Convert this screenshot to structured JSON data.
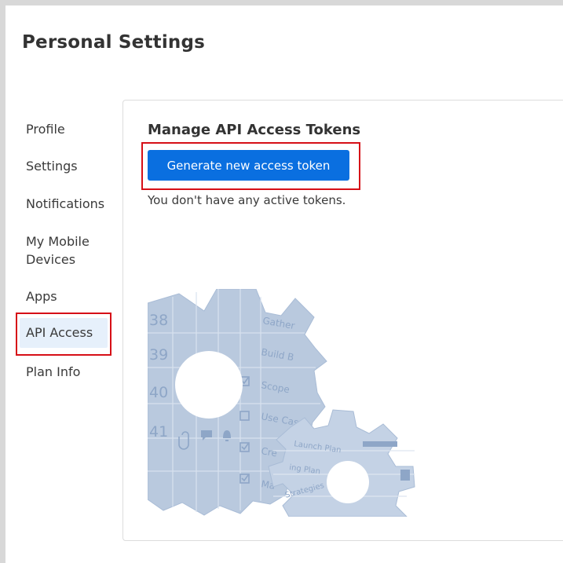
{
  "header": {
    "title": "Personal Settings"
  },
  "sidebar": {
    "items": [
      {
        "label": "Profile"
      },
      {
        "label": "Settings"
      },
      {
        "label": "Notifications"
      },
      {
        "label": "My Mobile\nDevices"
      },
      {
        "label": "Apps"
      },
      {
        "label": "API Access",
        "active": true
      },
      {
        "label": "Plan Info"
      }
    ]
  },
  "main": {
    "title": "Manage API Access Tokens",
    "generate_button_label": "Generate new access token",
    "empty_message": "You don't have any active tokens."
  },
  "illustration": {
    "row_numbers": [
      "38",
      "39",
      "40",
      "41"
    ],
    "row_labels": [
      "Gather",
      "Build B",
      "Scope",
      "Use Cases",
      "Cre",
      "Ma"
    ],
    "small_gear_labels": [
      "Launch Plan",
      "ing Plan",
      "Strategies"
    ]
  },
  "colors": {
    "accent": "#0a6fe0",
    "highlight": "#d60f17",
    "active_bg": "#e6f0fb"
  }
}
